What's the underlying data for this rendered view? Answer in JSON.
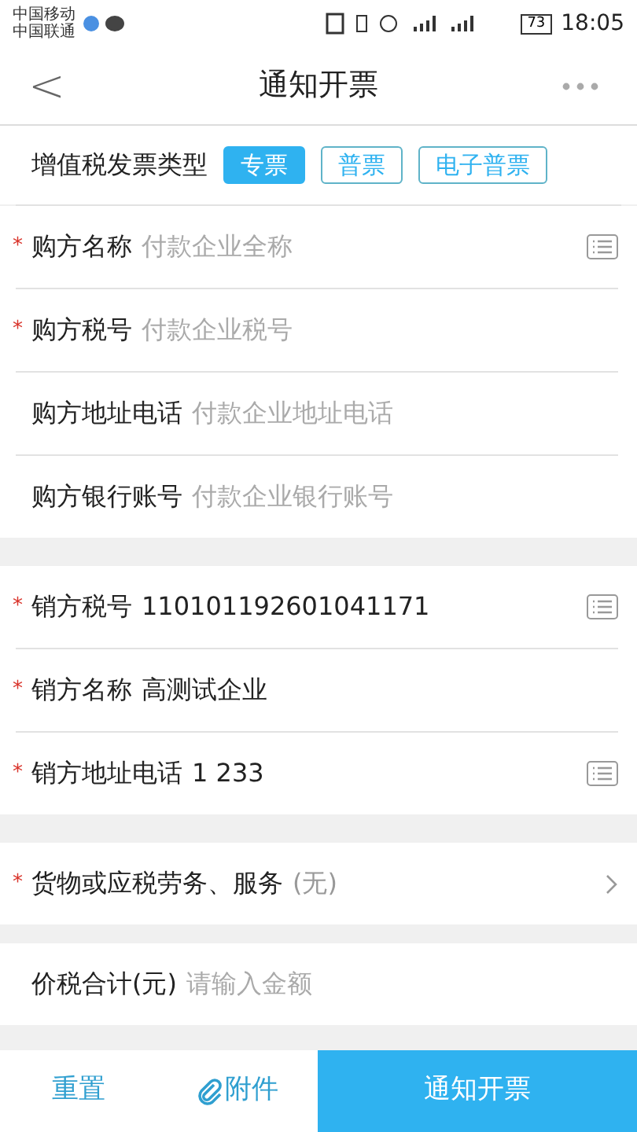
{
  "status_bar": {
    "carriers": [
      "中国移动",
      "中国联通"
    ],
    "battery": "73",
    "time": "18:05"
  },
  "header": {
    "back": "<",
    "title": "通知开票"
  },
  "invoice_type": {
    "label": "增值税发票类型",
    "options": [
      {
        "label": "专票",
        "selected": true
      },
      {
        "label": "普票",
        "selected": false
      },
      {
        "label": "电子普票",
        "selected": false
      }
    ]
  },
  "sections": [
    [
      {
        "kind": "input",
        "required_mark": "*",
        "label": "购方名称",
        "placeholder": "付款企业全称",
        "picker": true
      },
      {
        "kind": "input",
        "required_mark": "*",
        "label": "购方税号",
        "placeholder": "付款企业税号",
        "picker": false
      },
      {
        "kind": "input",
        "label": "购方地址电话",
        "placeholder": "付款企业地址电话",
        "picker": false
      },
      {
        "kind": "input",
        "label": "购方银行账号",
        "placeholder": "付款企业银行账号",
        "picker": false
      }
    ],
    [
      {
        "kind": "input",
        "required_mark": "*",
        "label": "销方税号",
        "value": "110101192601041171",
        "picker": true
      },
      {
        "kind": "input",
        "required_mark": "*",
        "label": "销方名称",
        "value": "高测试企业",
        "picker": false
      },
      {
        "kind": "input",
        "required_mark": "*",
        "label": "销方地址电话",
        "value": "1 233",
        "picker": true
      }
    ],
    [
      {
        "kind": "link",
        "required_mark": "*",
        "label": "货物或应税劳务、服务",
        "value": "(无)"
      }
    ],
    [
      {
        "kind": "input",
        "label": "价税合计(元)",
        "placeholder": "请输入金额",
        "picker": false
      }
    ]
  ],
  "footer": {
    "reset": "重置",
    "attach": "附件",
    "submit": "通知开票"
  }
}
